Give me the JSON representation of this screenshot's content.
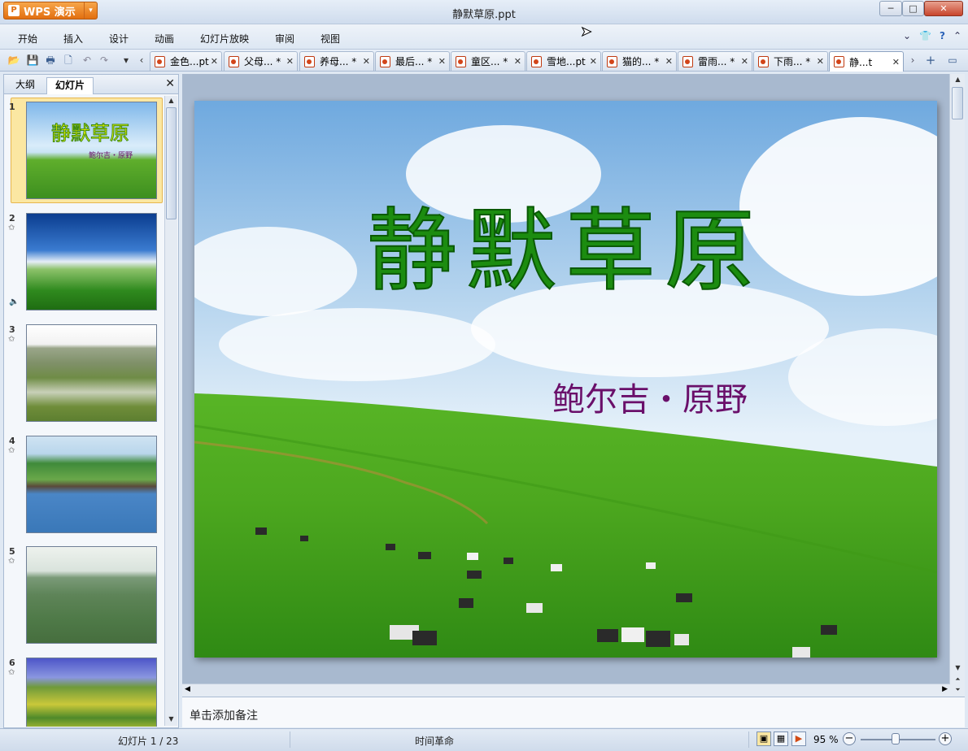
{
  "app": {
    "name": "WPS 演示",
    "logo_letter": "P",
    "window_title": "静默草原.ppt"
  },
  "window_controls": {
    "minimize": "─",
    "maximize": "□",
    "close": "✕"
  },
  "menu": {
    "items": [
      "开始",
      "插入",
      "设计",
      "动画",
      "幻灯片放映",
      "审阅",
      "视图"
    ],
    "right": {
      "collapse_icon": "chevron-down-icon",
      "skin_icon": "shirt-icon",
      "help_icon": "help-icon"
    }
  },
  "doc_tabs": [
    {
      "label": "金色...pt",
      "active": false
    },
    {
      "label": "父母... *",
      "active": false
    },
    {
      "label": "养母... *",
      "active": false
    },
    {
      "label": "最后... *",
      "active": false
    },
    {
      "label": "童区... *",
      "active": false
    },
    {
      "label": "雪地...pt",
      "active": false
    },
    {
      "label": "猫的... *",
      "active": false
    },
    {
      "label": "雷雨... *",
      "active": false
    },
    {
      "label": "下雨... *",
      "active": false
    },
    {
      "label": "静...t",
      "active": true
    }
  ],
  "left_panel": {
    "tab_outline": "大纲",
    "tab_slides": "幻灯片",
    "close": "✕",
    "thumb_text": {
      "title": "静默草原",
      "subtitle": "鲍尔吉・原野"
    },
    "slides": [
      {
        "num": "1",
        "selected": true
      },
      {
        "num": "2",
        "selected": false
      },
      {
        "num": "3",
        "selected": false
      },
      {
        "num": "4",
        "selected": false
      },
      {
        "num": "5",
        "selected": false
      },
      {
        "num": "6",
        "selected": false
      }
    ]
  },
  "slide": {
    "title": "静默草原",
    "subtitle": "鲍尔吉・原野"
  },
  "notes": {
    "placeholder": "单击添加备注"
  },
  "status": {
    "slide_counter": "幻灯片 1 / 23",
    "theme": "时间革命",
    "zoom_level": "95 %",
    "zoom_value": 0.95
  }
}
